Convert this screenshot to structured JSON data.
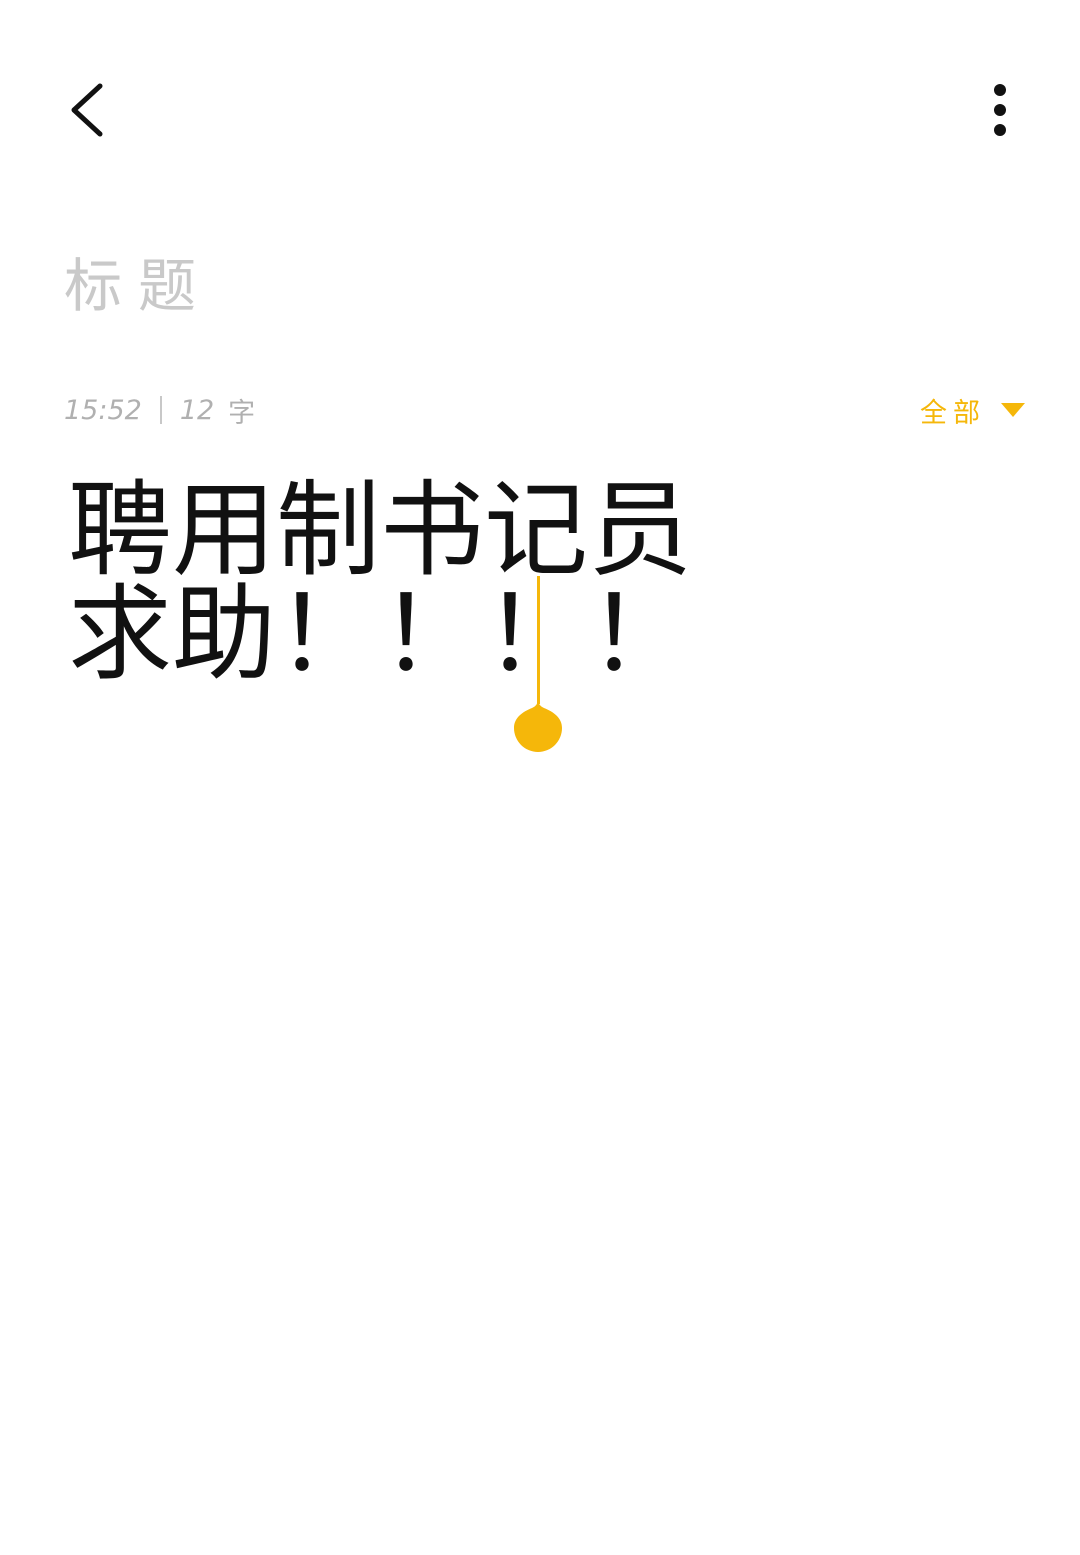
{
  "header": {
    "back_icon": "chevron-left-icon",
    "more_icon": "more-vertical-icon"
  },
  "title": {
    "placeholder": "标题",
    "value": ""
  },
  "meta": {
    "time": "15:52",
    "count": "12",
    "unit": "字"
  },
  "filter": {
    "label": "全部",
    "icon": "triangle-down-icon"
  },
  "body": {
    "line1": "聘用制书记员",
    "line2": "求助！！！！"
  },
  "colors": {
    "accent": "#f5b70a",
    "text": "#111111",
    "muted": "#b0b0b0",
    "placeholder": "#c9c9c9"
  }
}
